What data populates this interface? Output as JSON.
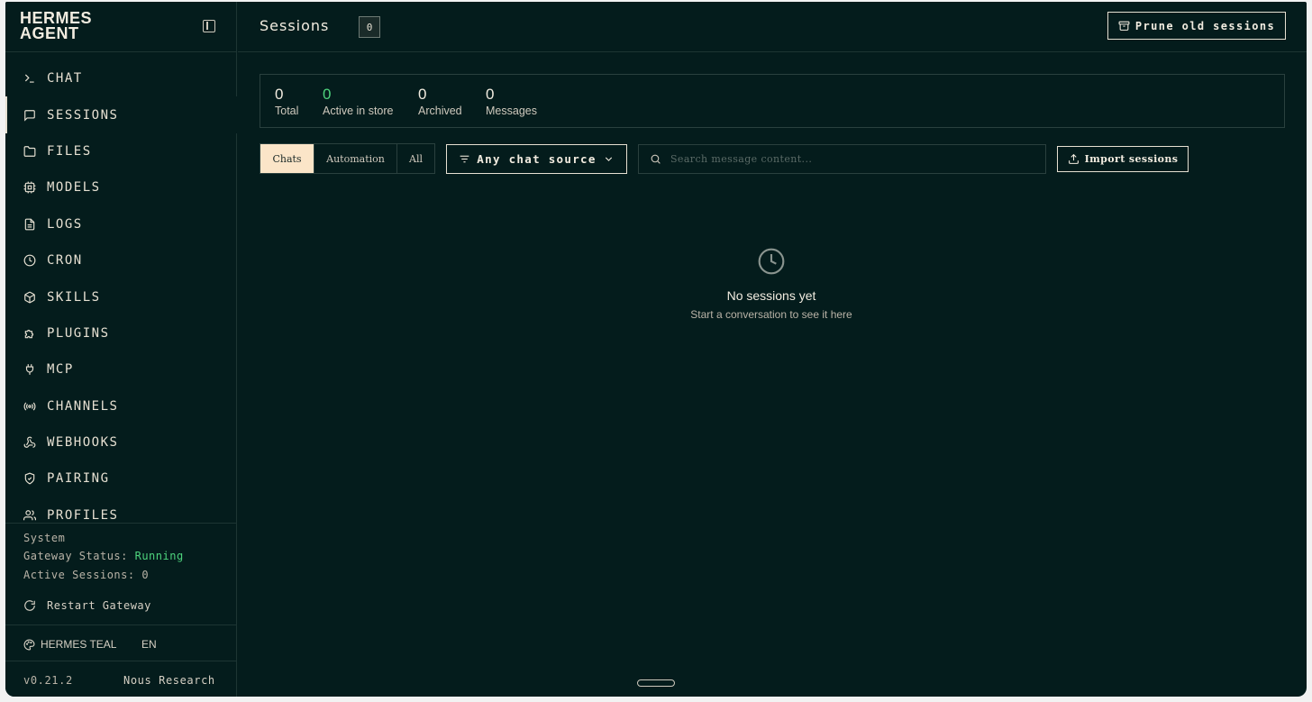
{
  "brand": {
    "title": "HERMES\nAGENT"
  },
  "nav": [
    {
      "label": "CHAT",
      "icon": "terminal-icon"
    },
    {
      "label": "SESSIONS",
      "icon": "message-square-icon",
      "active": true
    },
    {
      "label": "FILES",
      "icon": "folder-icon"
    },
    {
      "label": "MODELS",
      "icon": "cpu-icon"
    },
    {
      "label": "LOGS",
      "icon": "file-text-icon"
    },
    {
      "label": "CRON",
      "icon": "clock-icon"
    },
    {
      "label": "SKILLS",
      "icon": "package-icon"
    },
    {
      "label": "PLUGINS",
      "icon": "puzzle-icon"
    },
    {
      "label": "MCP",
      "icon": "plug-icon"
    },
    {
      "label": "CHANNELS",
      "icon": "radio-icon"
    },
    {
      "label": "WEBHOOKS",
      "icon": "webhook-icon"
    },
    {
      "label": "PAIRING",
      "icon": "shield-icon"
    },
    {
      "label": "PROFILES",
      "icon": "users-icon"
    }
  ],
  "system": {
    "heading": "System",
    "gateway_label": "Gateway Status:",
    "gateway_value": "Running",
    "sessions_label": "Active Sessions:",
    "sessions_value": "0",
    "restart_label": "Restart Gateway"
  },
  "theme": {
    "label": "HERMES TEAL",
    "lang": "EN"
  },
  "footer": {
    "version": "v0.21.2",
    "org": "Nous Research"
  },
  "header": {
    "title": "Sessions",
    "count": "0",
    "prune_label": "Prune old sessions"
  },
  "stats": [
    {
      "value": "0",
      "label": "Total"
    },
    {
      "value": "0",
      "label": "Active in store"
    },
    {
      "value": "0",
      "label": "Archived"
    },
    {
      "value": "0",
      "label": "Messages"
    }
  ],
  "filters": {
    "tabs": [
      "Chats",
      "Automation",
      "All"
    ],
    "active_tab": "Chats",
    "source_label": "Any chat source",
    "search_placeholder": "Search message content...",
    "import_label": "Import sessions"
  },
  "empty": {
    "title": "No sessions yet",
    "subtitle": "Start a conversation to see it here"
  },
  "colors": {
    "background": "#041c1c",
    "accent_green": "#4ed47d",
    "active_tab_bg": "#fbe5c8",
    "text": "#f2ece0"
  }
}
